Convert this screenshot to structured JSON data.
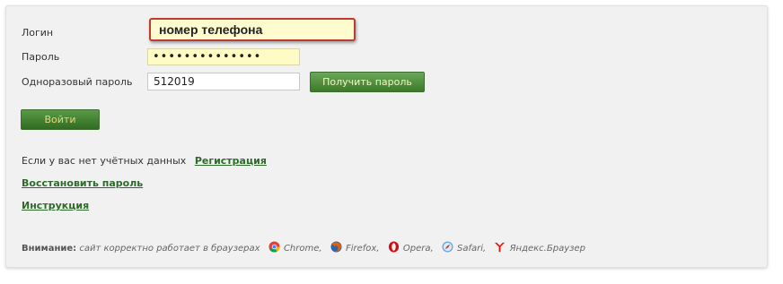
{
  "form": {
    "login_label": "Логин",
    "login_value": "номер телефона",
    "password_label": "Пароль",
    "password_value": "••••••••••••••",
    "otp_label": "Одноразовый пароль",
    "otp_value": "512019",
    "get_password_button": "Получить пароль",
    "login_button": "Войти"
  },
  "links": {
    "no_account_text": "Если у вас нет учётных данных",
    "register": "Регистрация",
    "restore_password": "Восстановить пароль",
    "instructions": "Инструкция"
  },
  "notice": {
    "title": "Внимание:",
    "text": "сайт корректно работает в браузерах",
    "browsers": [
      {
        "name": "Chrome,",
        "icon": "chrome-icon"
      },
      {
        "name": "Firefox,",
        "icon": "firefox-icon"
      },
      {
        "name": "Opera,",
        "icon": "opera-icon"
      },
      {
        "name": "Safari,",
        "icon": "safari-icon"
      },
      {
        "name": "Яндекс.Браузер",
        "icon": "yandex-browser-icon"
      }
    ]
  },
  "colors": {
    "accent_green": "#3c7a2b",
    "link_green": "#2d6b2a",
    "highlight_red": "#c03a2f",
    "field_yellow": "#fefccf"
  }
}
